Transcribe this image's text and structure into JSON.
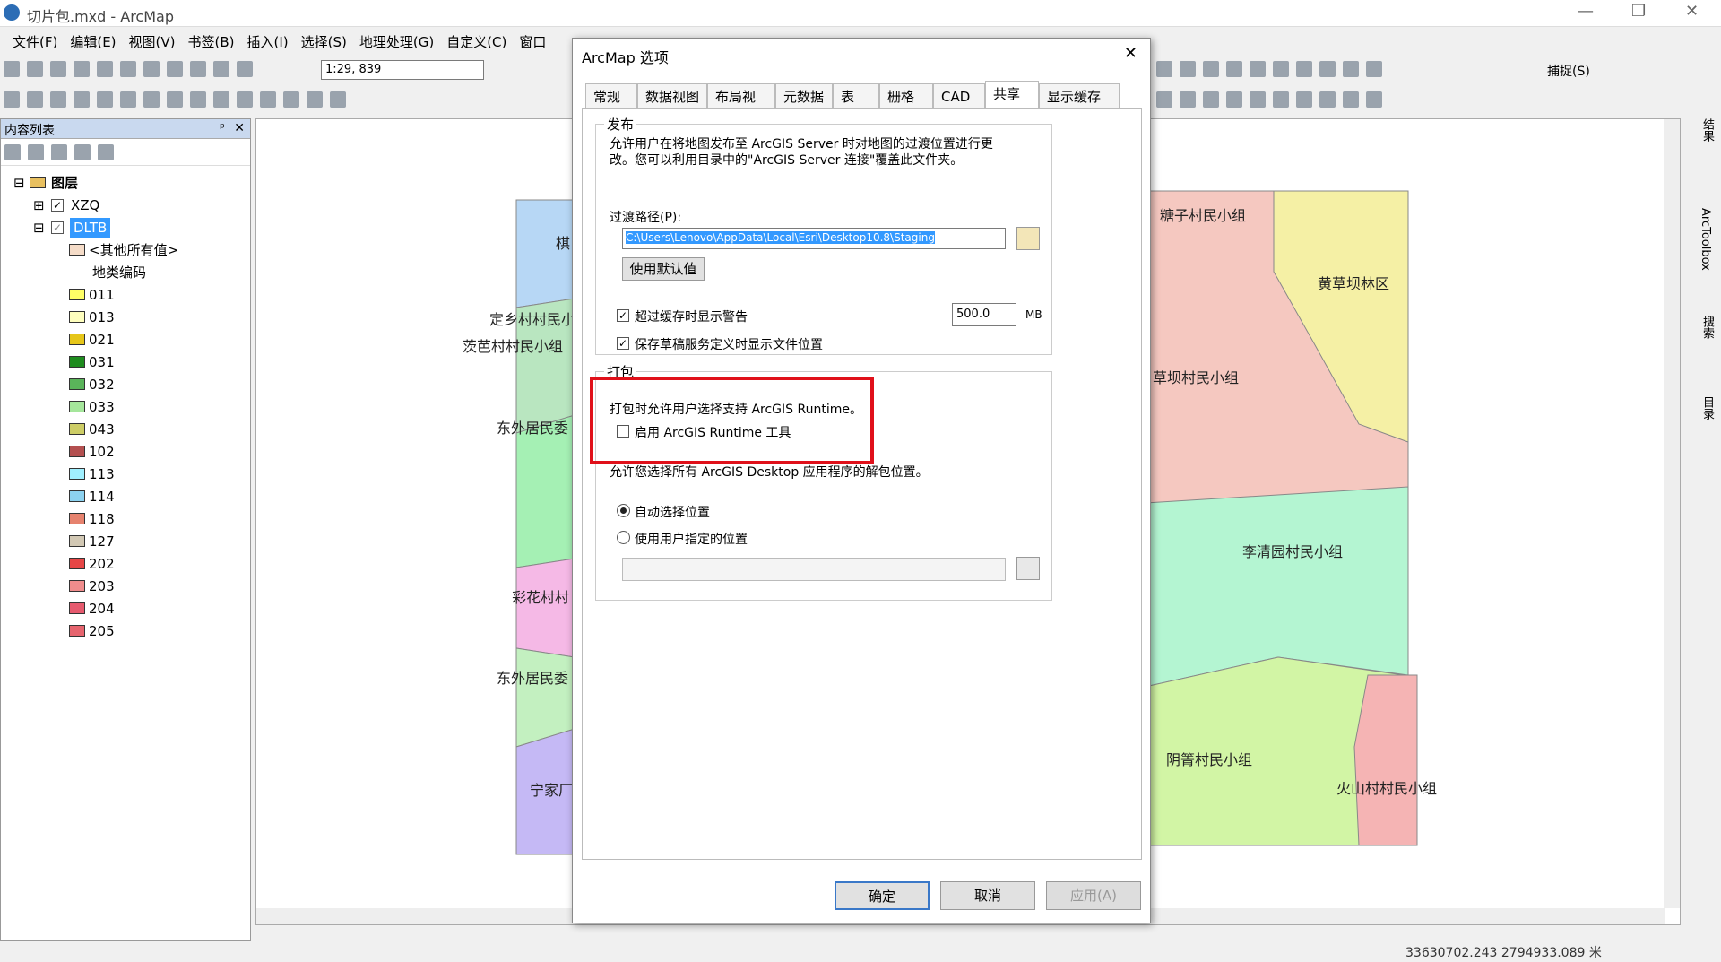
{
  "window": {
    "title": "切片包.mxd - ArcMap",
    "minimize": "—",
    "restore": "❐",
    "close": "✕"
  },
  "menu": [
    "文件(F)",
    "编辑(E)",
    "视图(V)",
    "书签(B)",
    "插入(I)",
    "选择(S)",
    "地理处理(G)",
    "自定义(C)",
    "窗口"
  ],
  "toolbar": {
    "scale": "1:29, 839",
    "snap_label": "捕捉(S)"
  },
  "toc": {
    "title": "内容列表",
    "pin": "ᵖ",
    "close": "✕",
    "root": "图层",
    "layer1": "XZQ",
    "layer2": "DLTB",
    "other": "<其他所有值>",
    "field": "地类编码",
    "classes": [
      {
        "code": "011",
        "color": "#ffff66"
      },
      {
        "code": "013",
        "color": "#ffffbe"
      },
      {
        "code": "021",
        "color": "#e6c619"
      },
      {
        "code": "031",
        "color": "#1e8c1e"
      },
      {
        "code": "032",
        "color": "#5ab45a"
      },
      {
        "code": "033",
        "color": "#a5e69b"
      },
      {
        "code": "043",
        "color": "#cdcd66"
      },
      {
        "code": "102",
        "color": "#b45050"
      },
      {
        "code": "113",
        "color": "#a0f0ff"
      },
      {
        "code": "114",
        "color": "#8cd2f0"
      },
      {
        "code": "118",
        "color": "#e6826e"
      },
      {
        "code": "127",
        "color": "#d2c8b4"
      },
      {
        "code": "202",
        "color": "#e64646"
      },
      {
        "code": "203",
        "color": "#f08c8c"
      },
      {
        "code": "204",
        "color": "#e65a6e"
      },
      {
        "code": "205",
        "color": "#e6646e"
      }
    ]
  },
  "map": {
    "labels_left": [
      "棋",
      "定乡村村民小",
      "茨芭村村民小组",
      "东外居民委",
      "彩花村村",
      "东外居民委",
      "宁家厂"
    ],
    "labels_right": [
      "糖子村民小组",
      "黄草坝林区",
      "草坝村民小组",
      "李清园村民小组",
      "阴箐村民小组",
      "火山村村民小组"
    ]
  },
  "side_tabs": [
    "结果",
    "ArcToolbox",
    "搜索",
    "目录"
  ],
  "dialog": {
    "title": "ArcMap 选项",
    "close": "✕",
    "tabs": [
      "常规",
      "数据视图",
      "布局视图",
      "元数据",
      "表",
      "栅格",
      "CAD",
      "共享",
      "显示缓存"
    ],
    "publish_group": "发布",
    "publish_desc_1": "允许用户在将地图发布至 ArcGIS Server 时对地图的过渡位置进行更",
    "publish_desc_2": "改。您可以利用目录中的\"ArcGIS Server 连接\"覆盖此文件夹。",
    "staging_label": "过渡路径(P):",
    "staging_path": "C:\\Users\\Lenovo\\AppData\\Local\\Esri\\Desktop10.8\\Staging",
    "use_default": "使用默认值",
    "warn_cache": "超过缓存时显示警告",
    "cache_size": "500.0",
    "cache_unit": "MB",
    "show_location": "保存草稿服务定义时显示文件位置",
    "package_group": "打包",
    "package_desc": "打包时允许用户选择支持 ArcGIS Runtime。",
    "enable_runtime": "启用 ArcGIS Runtime 工具",
    "unpack_desc": "允许您选择所有 ArcGIS Desktop 应用程序的解包位置。",
    "auto_location": "自动选择位置",
    "user_location": "使用用户指定的位置",
    "ok": "确定",
    "cancel": "取消",
    "apply": "应用(A)"
  },
  "status": {
    "coords": "33630702.243  2794933.089 米"
  }
}
